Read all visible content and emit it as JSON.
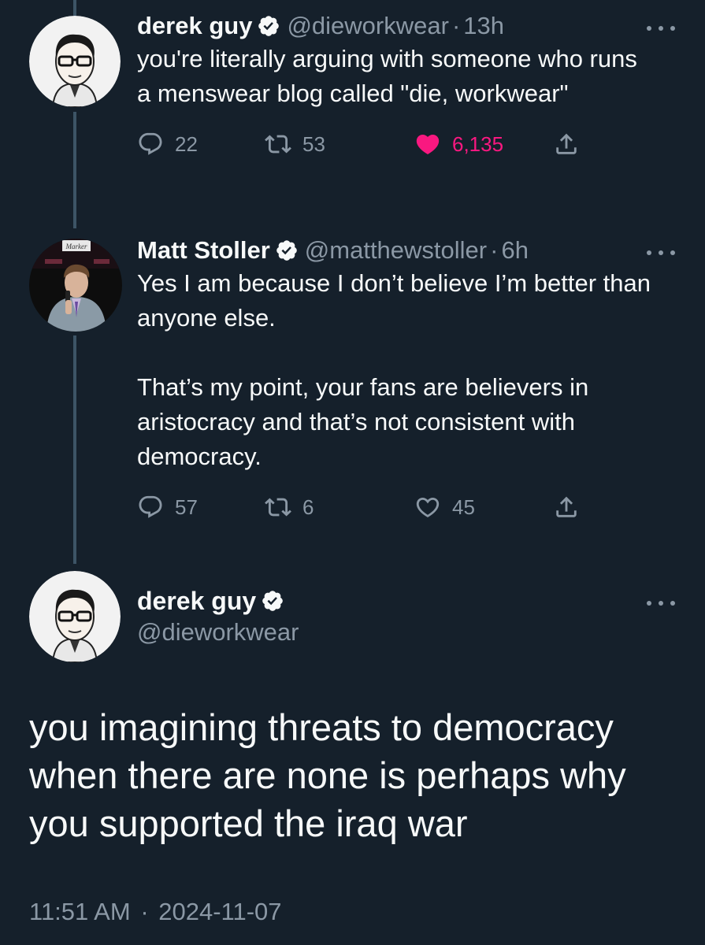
{
  "tweets": [
    {
      "name": "derek guy",
      "handle": "@dieworkwear",
      "time": "13h",
      "text": "you're literally arguing with someone who runs a menswear blog called \"die, workwear\"",
      "replies": "22",
      "retweets": "53",
      "likes": "6,135",
      "liked": true
    },
    {
      "name": "Matt Stoller",
      "handle": "@matthewstoller",
      "time": "6h",
      "text": "Yes I am because I don’t believe I’m better than anyone else.\n\nThat’s my point, your fans are believers in aristocracy and that’s not consistent with democracy.",
      "replies": "57",
      "retweets": "6",
      "likes": "45",
      "liked": false
    }
  ],
  "main_tweet": {
    "name": "derek guy",
    "handle": "@dieworkwear",
    "text": "you imagining threats to democracy when there are none is perhaps why you supported the iraq war",
    "time": "11:51 AM",
    "date": "2024-11-07"
  },
  "separator": "·",
  "avatar_2_sign": "Marker",
  "colors": {
    "background": "#15202b",
    "text": "#f7f9f9",
    "secondary": "#8b98a5",
    "like": "#f91880",
    "verified": "#f7f9f9",
    "thread_line": "#3d5466"
  }
}
